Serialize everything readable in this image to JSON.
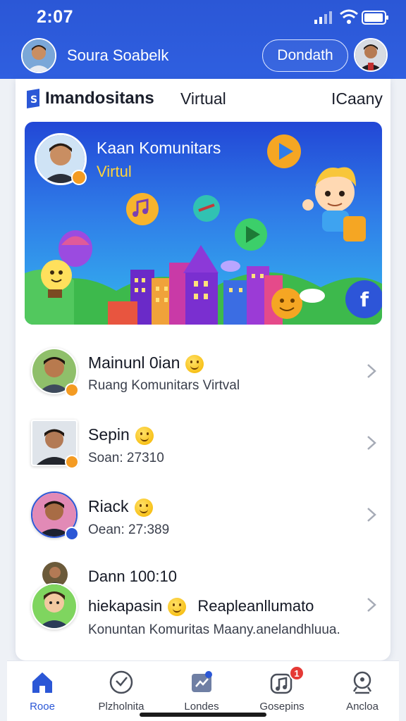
{
  "status": {
    "time": "2:07"
  },
  "header": {
    "title": "Soura Soabelk",
    "pill_label": "Dondath"
  },
  "tabs": {
    "main": "Imandositans",
    "virtual": "Virtual",
    "right": "ICaany"
  },
  "banner": {
    "title": "Kaan Komunitars",
    "subtitle": "Virtul",
    "fb_label": "f"
  },
  "list": [
    {
      "name": "Mainunl 0ian",
      "sub": "Ruang Komunitars Virtval"
    },
    {
      "name": "Sepin",
      "sub": "Soan: 27310"
    },
    {
      "name": "Riack",
      "sub": "Oean: 27:389"
    },
    {
      "name": "Dann 100:10",
      "line2": "hiekapasin",
      "line2b": "Reapleanllumato",
      "sub": "Konuntan Komuritas Maany.anelandhluua."
    }
  ],
  "nav": [
    {
      "label": "Rooe",
      "icon": "home-icon",
      "active": true
    },
    {
      "label": "Plzholnita",
      "icon": "compass-icon",
      "active": false
    },
    {
      "label": "Londes",
      "icon": "activity-icon",
      "active": false
    },
    {
      "label": "Gosepins",
      "icon": "music-icon",
      "active": false,
      "badge": "1"
    },
    {
      "label": "Ancloa",
      "icon": "profile-icon",
      "active": false
    }
  ],
  "colors": {
    "brand": "#2b57d6",
    "accent_orange": "#f49b22",
    "badge_red": "#e53935"
  }
}
